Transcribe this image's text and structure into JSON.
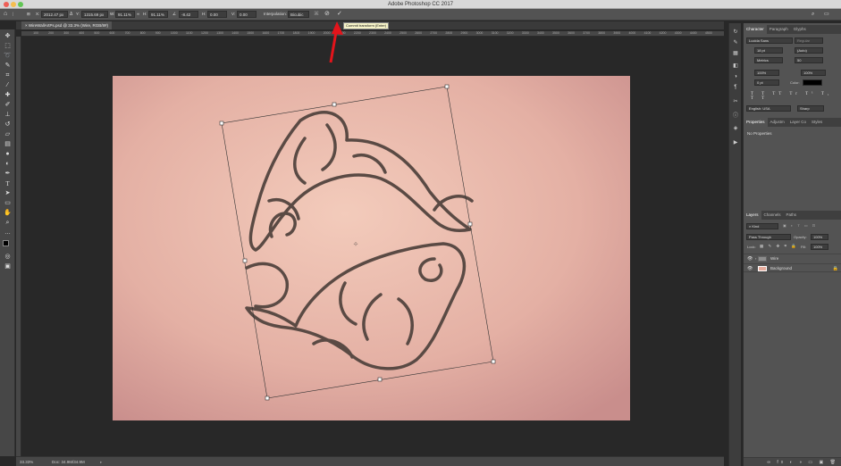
{
  "window": {
    "title": "Adobe Photoshop CC 2017"
  },
  "options_bar": {
    "x_label": "X:",
    "x_value": "2012.47 px",
    "y_label": "Y:",
    "y_value": "1315.69 px",
    "w_label": "W:",
    "w_value": "91.11%",
    "h_label": "H:",
    "h_value": "91.11%",
    "angle_value": "-8.42",
    "hskew_label": "H:",
    "hskew_value": "0.00",
    "vskew_label": "V:",
    "vskew_value": "0.00",
    "interpolation_label": "Interpolation:",
    "interpolation_value": "Bicubic"
  },
  "tooltip": "Commit transform (Enter)",
  "document_tab": "WireWallArtPs.psd @ 33.3% (Wire, RGB/8#)",
  "ruler_ticks": [
    "100",
    "200",
    "300",
    "400",
    "500",
    "600",
    "700",
    "800",
    "900",
    "1000",
    "1100",
    "1200",
    "1300",
    "1400",
    "1500",
    "1600",
    "1700",
    "1800",
    "1900",
    "2000",
    "2100",
    "2200",
    "2300",
    "2400",
    "2500",
    "2600",
    "2700",
    "2800",
    "2900",
    "3000",
    "3100",
    "3200",
    "3300",
    "3400",
    "3500",
    "3600",
    "3700",
    "3800",
    "3900",
    "4000",
    "4100",
    "4200",
    "4300",
    "4400",
    "4500"
  ],
  "status": {
    "zoom": "33.33%",
    "doc": "Doc: 34.9M/34.9M"
  },
  "character_panel": {
    "tabs": [
      "Character",
      "Paragraph",
      "Glyphs"
    ],
    "font_family": "Lucida Sans",
    "font_style": "Regular",
    "font_size": "18 pt",
    "leading": "(Auto)",
    "kerning": "Metrics",
    "tracking": "50",
    "vscale": "100%",
    "hscale": "100%",
    "baseline": "0 pt",
    "color_label": "Color:",
    "language": "English: USA",
    "antialias": "Sharp"
  },
  "properties_panel": {
    "tabs": [
      "Properties",
      "Adjustm",
      "Layer Co",
      "Styles"
    ],
    "empty_text": "No Properties"
  },
  "layers_panel": {
    "tabs": [
      "Layers",
      "Channels",
      "Paths"
    ],
    "filter_kind": "Kind",
    "blend_mode": "Pass Through",
    "opacity_label": "Opacity:",
    "opacity_value": "100%",
    "lock_label": "Lock:",
    "fill_label": "Fill:",
    "fill_value": "100%",
    "layers": [
      {
        "name": "Wire",
        "type": "group"
      },
      {
        "name": "Background",
        "type": "image"
      }
    ]
  },
  "colors": {
    "canvas_bg": "#e7b5a8",
    "wire": "#5a4a44"
  }
}
